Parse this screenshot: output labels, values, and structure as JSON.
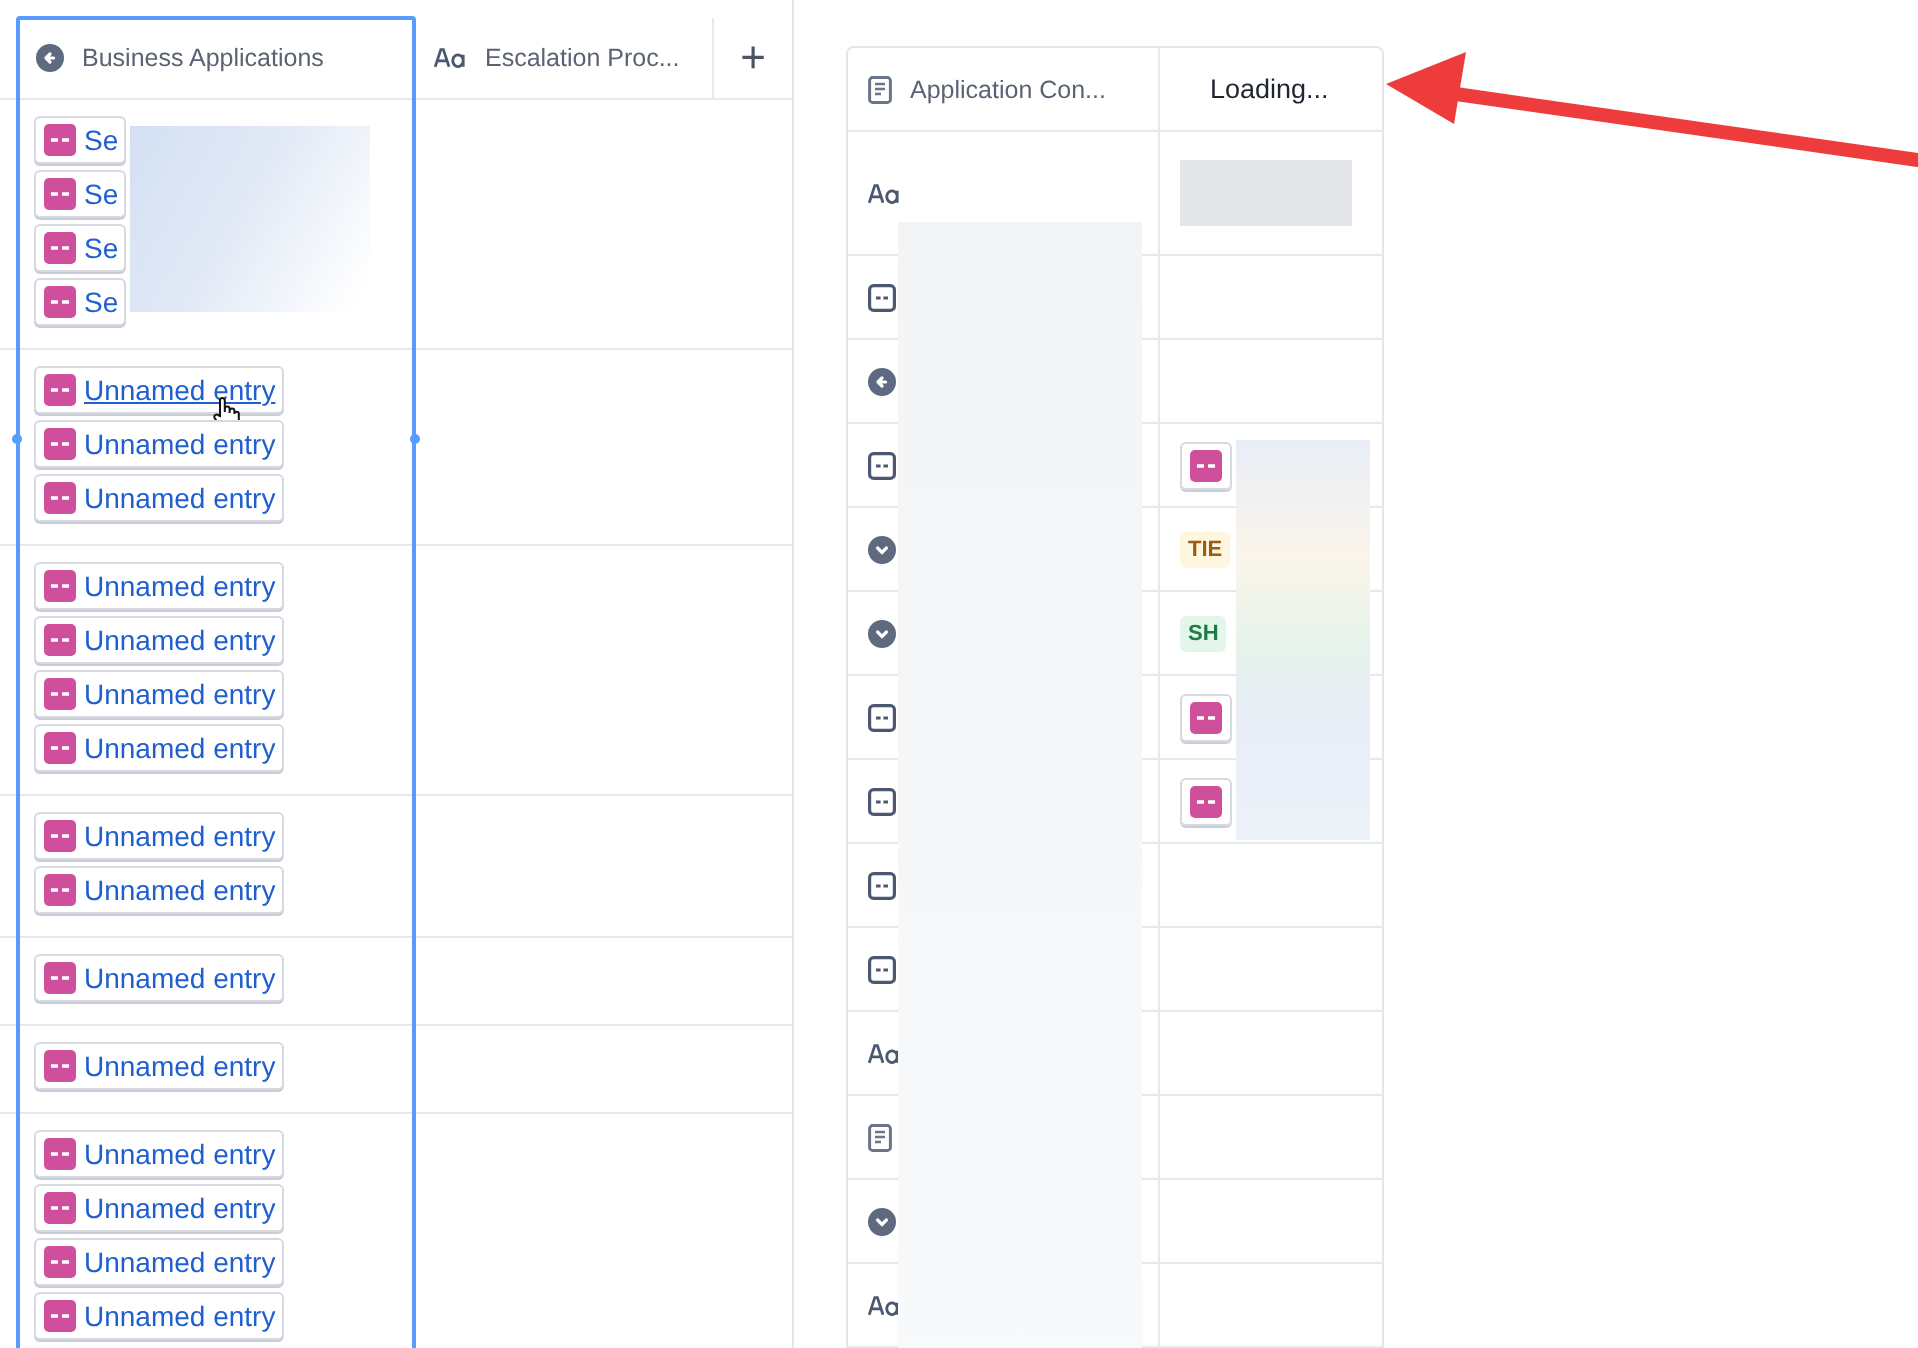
{
  "left_table": {
    "columns": [
      {
        "label": "Business Applications",
        "kind": "back",
        "selected": true
      },
      {
        "label": "Escalation Proc...",
        "kind": "text",
        "selected": false
      }
    ],
    "add_label": "+",
    "groups": [
      {
        "entries": [
          {
            "text": "Se",
            "hovered": false
          },
          {
            "text": "Se",
            "hovered": false
          },
          {
            "text": "Se",
            "hovered": false
          },
          {
            "text": "Se",
            "hovered": false
          }
        ],
        "redacted": true
      },
      {
        "entries": [
          {
            "text": "Unnamed entry",
            "hovered": true
          },
          {
            "text": "Unnamed entry",
            "hovered": false
          },
          {
            "text": "Unnamed entry",
            "hovered": false
          }
        ]
      },
      {
        "entries": [
          {
            "text": "Unnamed entry",
            "hovered": false
          },
          {
            "text": "Unnamed entry",
            "hovered": false
          },
          {
            "text": "Unnamed entry",
            "hovered": false
          },
          {
            "text": "Unnamed entry",
            "hovered": false
          }
        ]
      },
      {
        "entries": [
          {
            "text": "Unnamed entry",
            "hovered": false
          },
          {
            "text": "Unnamed entry",
            "hovered": false
          }
        ]
      },
      {
        "entries": [
          {
            "text": "Unnamed entry",
            "hovered": false
          }
        ]
      },
      {
        "entries": [
          {
            "text": "Unnamed entry",
            "hovered": false
          }
        ]
      },
      {
        "entries": [
          {
            "text": "Unnamed entry",
            "hovered": false
          },
          {
            "text": "Unnamed entry",
            "hovered": false
          },
          {
            "text": "Unnamed entry",
            "hovered": false
          },
          {
            "text": "Unnamed entry",
            "hovered": false
          }
        ]
      }
    ]
  },
  "right_table": {
    "columns": [
      {
        "label": "Application Con...",
        "kind": "document"
      },
      {
        "label": "Loading..."
      }
    ],
    "rows": [
      {
        "kind": "text",
        "value": {
          "kind": "redacted"
        }
      },
      {
        "kind": "entry",
        "value": {
          "kind": "blank"
        }
      },
      {
        "kind": "back",
        "value": {
          "kind": "blank"
        }
      },
      {
        "kind": "entry",
        "value": {
          "kind": "chip"
        }
      },
      {
        "kind": "chevron",
        "value": {
          "kind": "tag",
          "text": "TIE",
          "color": "#9a5b13"
        }
      },
      {
        "kind": "chevron",
        "value": {
          "kind": "tag",
          "text": "SH",
          "color": "#1e7a46"
        }
      },
      {
        "kind": "entry",
        "value": {
          "kind": "chip"
        }
      },
      {
        "kind": "entry",
        "value": {
          "kind": "chip"
        }
      },
      {
        "kind": "entry",
        "value": {
          "kind": "blank"
        }
      },
      {
        "kind": "entry",
        "value": {
          "kind": "blank"
        }
      },
      {
        "kind": "text",
        "value": {
          "kind": "blank"
        }
      },
      {
        "kind": "document",
        "value": {
          "kind": "blank"
        }
      },
      {
        "kind": "chevron",
        "value": {
          "kind": "blank"
        }
      },
      {
        "kind": "text",
        "value": {
          "kind": "blank"
        }
      }
    ]
  }
}
